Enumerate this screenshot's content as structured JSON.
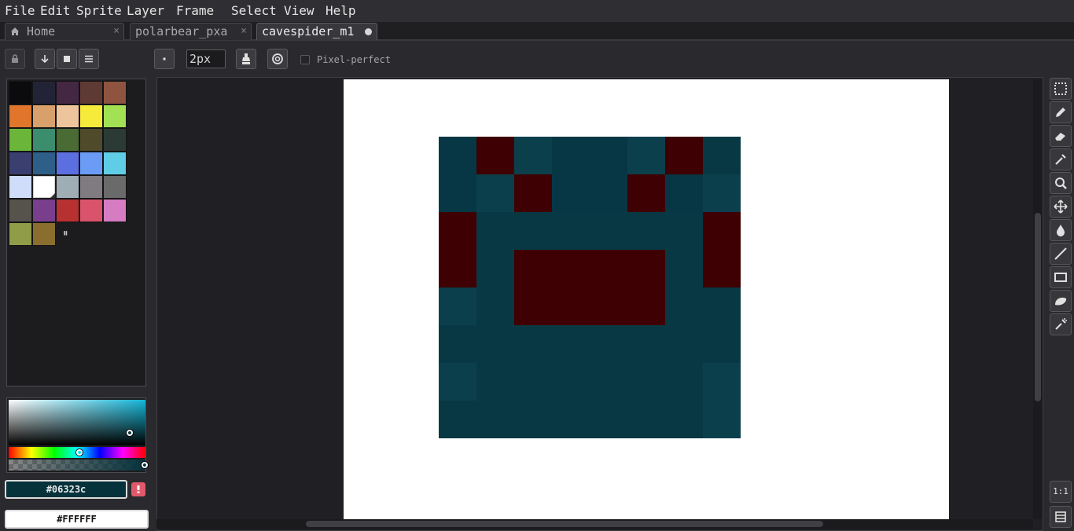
{
  "menu": [
    "File",
    "Edit",
    "Sprite",
    "Layer",
    "Frame",
    "Select",
    "View",
    "Help"
  ],
  "tabs": [
    {
      "label": "Home",
      "icon": "home-icon",
      "close": "×"
    },
    {
      "label": "polarbear_pxa",
      "close": "×"
    },
    {
      "label": "cavespider_m1",
      "modified": true
    }
  ],
  "toolbar": {
    "brush_size": "2px",
    "pixel_perfect_label": "Pixel-perfect",
    "pixel_perfect_checked": false,
    "lock_icon": "lock-icon",
    "buttons": [
      "arrow-down-icon",
      "save-icon",
      "menu-icon"
    ]
  },
  "palette": {
    "colors": [
      "#0b0b0d",
      "#232338",
      "#432743",
      "#5f3a34",
      "#8f5440",
      "#e0762b",
      "#d8a06a",
      "#eec49d",
      "#f6ea3b",
      "#a1e153",
      "#6bb53a",
      "#3c8c6e",
      "#4b6b35",
      "#4f4b2a",
      "#2c3a36",
      "#3a3f70",
      "#2e5f88",
      "#5b6fe0",
      "#6a9cf5",
      "#5fcde6",
      "#cfdcfa",
      "#ffffff",
      "#9fadb4",
      "#7f7b80",
      "#6a6a6a",
      "#56534c",
      "#7a3f8c",
      "#b83131",
      "#d9546a",
      "#d67cc3",
      "#909c47",
      "#8a6e2e"
    ],
    "selected_index": 21,
    "pause_icon": "pause-icon",
    "pause_glyph": "⏸"
  },
  "colors": {
    "foreground_hex": "#06323c",
    "background_hex": "#FFFFFF",
    "warning_icon": "warning-icon"
  },
  "sprite": {
    "grid": [
      [
        "#073744",
        "#3e0002",
        "#0c3f4c",
        "#073744",
        "#073744",
        "#0c3f4c",
        "#3e0002",
        "#083844"
      ],
      [
        "#073744",
        "#0c3f4c",
        "#3e0002",
        "#073744",
        "#073744",
        "#3e0002",
        "#073744",
        "#0c3f4c"
      ],
      [
        "#3e0002",
        "#083844",
        "#083844",
        "#083844",
        "#083844",
        "#083844",
        "#083844",
        "#3e0002"
      ],
      [
        "#3e0002",
        "#083844",
        "#3e0002",
        "#3e0002",
        "#3e0002",
        "#3e0002",
        "#083844",
        "#3e0002"
      ],
      [
        "#0c3f4c",
        "#083844",
        "#3e0002",
        "#3e0002",
        "#3e0002",
        "#3e0002",
        "#083844",
        "#083844"
      ],
      [
        "#083844",
        "#083844",
        "#083844",
        "#083844",
        "#083844",
        "#083844",
        "#083844",
        "#083844"
      ],
      [
        "#0c3f4c",
        "#083844",
        "#083844",
        "#083844",
        "#083844",
        "#083844",
        "#083844",
        "#0c3f4c"
      ],
      [
        "#083844",
        "#083844",
        "#083844",
        "#083844",
        "#083844",
        "#083844",
        "#083844",
        "#0c3f4c"
      ]
    ]
  },
  "tools": [
    "marquee-icon",
    "pencil-icon",
    "eraser-icon",
    "eyedropper-icon",
    "zoom-icon",
    "move-icon",
    "paint-bucket-icon",
    "line-icon",
    "rectangle-icon",
    "ellipse-icon",
    "spray-icon"
  ],
  "bottom_tools": {
    "zoom_label": "1:1",
    "timeline_icon": "timeline-icon"
  }
}
